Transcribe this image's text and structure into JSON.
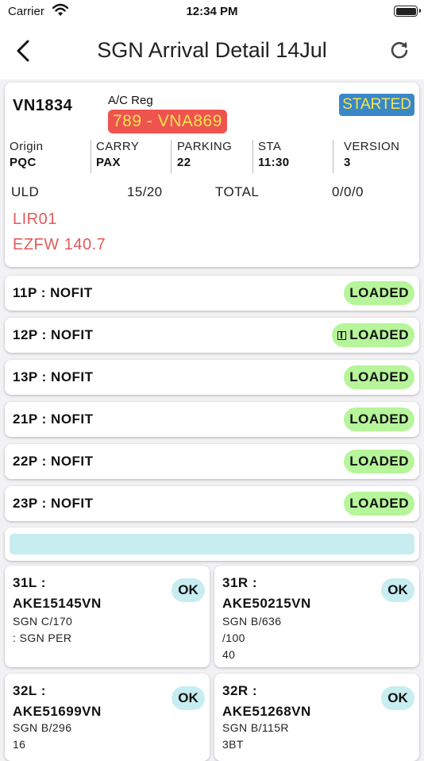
{
  "status_bar": {
    "carrier": "Carrier",
    "time": "12:34 PM"
  },
  "navbar": {
    "title": "SGN Arrival Detail 14Jul"
  },
  "flight": {
    "flight_no": "VN1834",
    "acreg_label": "A/C Reg",
    "acreg_value": "789 - VNA869",
    "status": "STARTED",
    "info": [
      {
        "label": "Origin",
        "value": "PQC"
      },
      {
        "label": "CARRY",
        "value": "PAX"
      },
      {
        "label": "PARKING",
        "value": "22"
      },
      {
        "label": "STA",
        "value": "11:30"
      },
      {
        "label": "VERSION",
        "value": "3"
      }
    ],
    "uld_label": "ULD",
    "uld_value": "15/20",
    "total_label": "TOTAL",
    "total_value": "0/0/0",
    "note1": "LIR01",
    "note2": "EZFW 140.7"
  },
  "load_items": [
    {
      "position": "11P : NOFIT",
      "status": "LOADED"
    },
    {
      "position": "12P : NOFIT",
      "status": "LOADED"
    },
    {
      "position": "13P : NOFIT",
      "status": "LOADED"
    },
    {
      "position": "21P : NOFIT",
      "status": "LOADED"
    },
    {
      "position": "22P : NOFIT",
      "status": "LOADED"
    },
    {
      "position": "23P : NOFIT",
      "status": "LOADED"
    }
  ],
  "progress": {
    "fraction": 0.0
  },
  "uld_cards": [
    {
      "position": "31L :",
      "uld": "AKE15145VN",
      "details": [
        "SGN C/170",
        ":   SGN PER"
      ],
      "status": "OK"
    },
    {
      "position": "31R :",
      "uld": "AKE50215VN",
      "details": [
        "SGN B/636",
        "/100",
        "40"
      ],
      "status": "OK"
    },
    {
      "position": "32L :",
      "uld": "AKE51699VN",
      "details": [
        "SGN B/296",
        "16"
      ],
      "status": "OK"
    },
    {
      "position": "32R :",
      "uld": "AKE51268VN",
      "details": [
        "SGN B/115R",
        "3BT"
      ],
      "status": "OK"
    }
  ],
  "colors": {
    "acreg_bg": "#ef5350",
    "acreg_text": "#f5e64a",
    "status_bg": "#3a87c8",
    "loaded_bg": "#b6f59a",
    "ok_bg": "#c7edf0",
    "note_red": "#e35b5b"
  }
}
